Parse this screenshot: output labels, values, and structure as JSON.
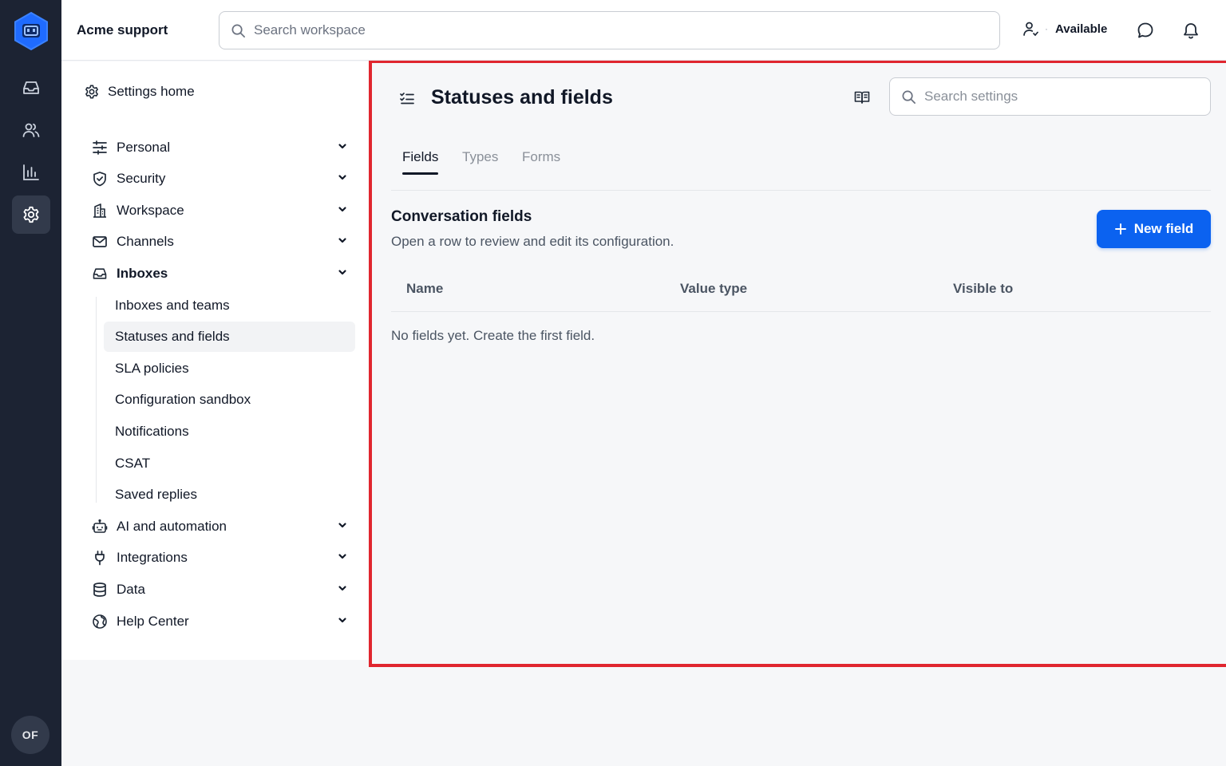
{
  "header": {
    "workspace_name": "Acme support",
    "search_placeholder": "Search workspace",
    "status_label": "Available",
    "status_dot": "·",
    "icons": [
      "user-status-icon",
      "chat-bubble-icon",
      "bell-icon"
    ]
  },
  "rail": {
    "items": [
      {
        "name": "inbox",
        "icon": "inbox-icon",
        "active": false
      },
      {
        "name": "contacts",
        "icon": "users-icon",
        "active": false
      },
      {
        "name": "reports",
        "icon": "bar-chart-icon",
        "active": false
      },
      {
        "name": "settings",
        "icon": "gear-icon",
        "active": true
      }
    ],
    "avatar_initials": "OF"
  },
  "settings_nav": {
    "home_label": "Settings home",
    "groups": [
      {
        "label": "Personal",
        "icon": "sliders-icon"
      },
      {
        "label": "Security",
        "icon": "shield-icon"
      },
      {
        "label": "Workspace",
        "icon": "building-icon"
      },
      {
        "label": "Channels",
        "icon": "envelope-icon"
      },
      {
        "label": "Inboxes",
        "icon": "inbox-icon",
        "expanded": true
      },
      {
        "label": "AI and automation",
        "icon": "robot-icon"
      },
      {
        "label": "Integrations",
        "icon": "plug-icon"
      },
      {
        "label": "Data",
        "icon": "database-icon"
      },
      {
        "label": "Help Center",
        "icon": "globe-icon"
      }
    ],
    "inbox_items": [
      {
        "label": "Inboxes and teams"
      },
      {
        "label": "Statuses and fields",
        "active": true
      },
      {
        "label": "SLA policies"
      },
      {
        "label": "Configuration sandbox"
      },
      {
        "label": "Notifications"
      },
      {
        "label": "CSAT"
      },
      {
        "label": "Saved replies"
      }
    ]
  },
  "main": {
    "title": "Statuses and fields",
    "search_placeholder": "Search settings",
    "tabs": [
      {
        "label": "Fields",
        "active": true
      },
      {
        "label": "Types",
        "active": false
      },
      {
        "label": "Forms",
        "active": false
      }
    ],
    "section_title": "Conversation fields",
    "section_description": "Open a row to review and edit its configuration.",
    "new_button_label": "New field",
    "columns": [
      "Name",
      "Value type",
      "Visible to"
    ],
    "empty_message": "No fields yet. Create the first field."
  },
  "colors": {
    "rail_bg": "#1c2333",
    "accent": "#0b62f0",
    "focus_outline": "#e0262f"
  }
}
